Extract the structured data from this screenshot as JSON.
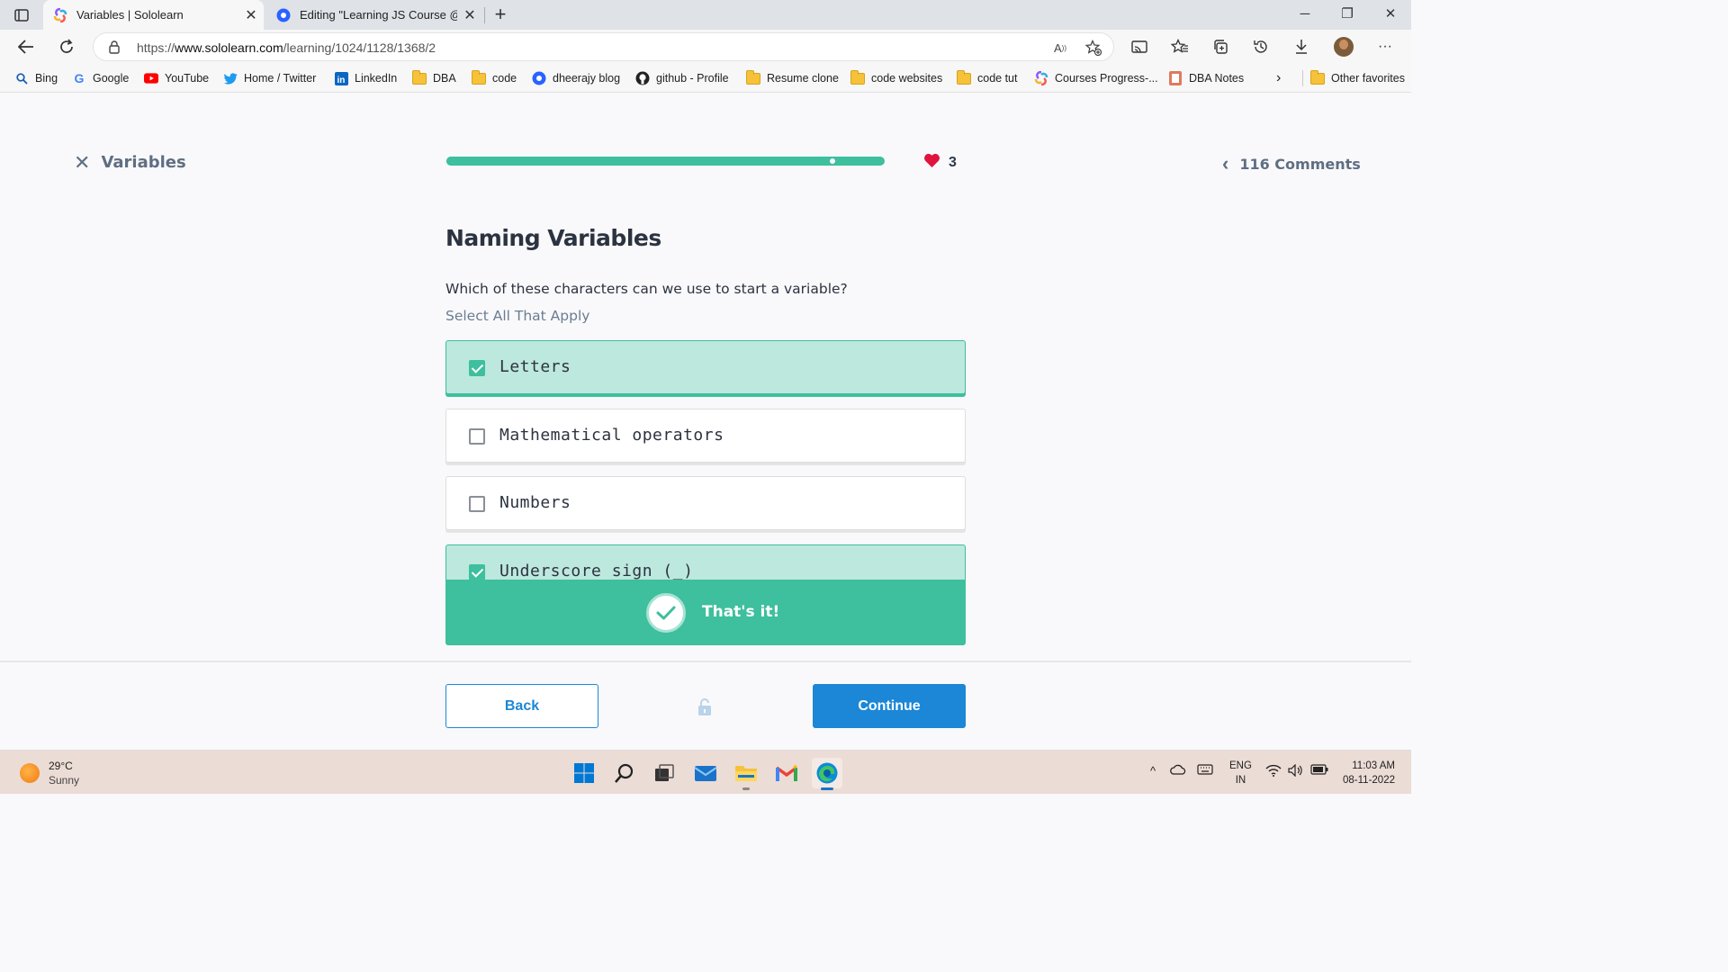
{
  "browser": {
    "tabs": [
      {
        "title": "Variables | Sololearn",
        "active": true
      },
      {
        "title": "Editing \"Learning JS Course @Sc",
        "active": false
      }
    ],
    "url_prefix": "https://",
    "url_domain": "www.sololearn.com",
    "url_path": "/learning/1024/1128/1368/2",
    "favorites": [
      {
        "label": "Bing",
        "icon": "search-icon"
      },
      {
        "label": "Google",
        "icon": "google-icon"
      },
      {
        "label": "YouTube",
        "icon": "youtube-icon"
      },
      {
        "label": "Home / Twitter",
        "icon": "twitter-icon"
      },
      {
        "label": "LinkedIn",
        "icon": "linkedin-icon"
      },
      {
        "label": "DBA",
        "icon": "folder-icon"
      },
      {
        "label": "code",
        "icon": "folder-icon"
      },
      {
        "label": "dheerajy blog",
        "icon": "blog-icon"
      },
      {
        "label": "github - Profile",
        "icon": "github-icon"
      },
      {
        "label": "Resume clone",
        "icon": "folder-icon"
      },
      {
        "label": "code websites",
        "icon": "folder-icon"
      },
      {
        "label": "code tut",
        "icon": "folder-icon"
      },
      {
        "label": "Courses Progress-...",
        "icon": "sololearn-icon"
      },
      {
        "label": "DBA Notes",
        "icon": "notes-icon"
      }
    ],
    "other_favorites": "Other favorites"
  },
  "lesson": {
    "title": "Variables",
    "progress": 0.94,
    "hearts": "3",
    "comments": "116 Comments"
  },
  "question": {
    "title": "Naming Variables",
    "text": "Which of these characters can we use to start a variable?",
    "hint": "Select All That Apply",
    "options": [
      {
        "label": "Letters",
        "checked": true
      },
      {
        "label": "Mathematical operators",
        "checked": false
      },
      {
        "label": "Numbers",
        "checked": false
      },
      {
        "label": "Underscore sign (_)",
        "checked": true
      }
    ],
    "feedback": "That's it!"
  },
  "footer": {
    "back": "Back",
    "continue": "Continue"
  },
  "taskbar": {
    "temperature": "29°C",
    "weather": "Sunny",
    "lang1": "ENG",
    "lang2": "IN",
    "time": "11:03 AM",
    "date": "08-11-2022"
  },
  "colors": {
    "accent_green": "#3ebf9d",
    "selected_bg": "#bde8de",
    "primary_blue": "#1b87d6",
    "heart_red": "#e0143c"
  }
}
